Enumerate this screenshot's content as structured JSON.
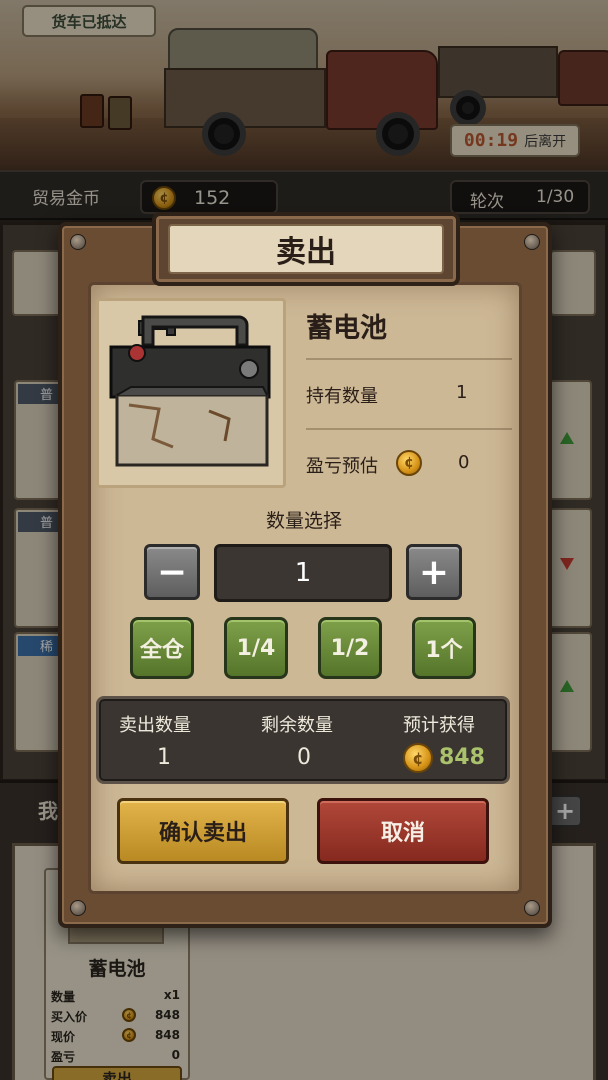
{
  "scene": {
    "arrived_label": "货车已抵达",
    "timer_value": "00:19",
    "timer_suffix": "后离开"
  },
  "hud": {
    "coins_label": "贸易金币",
    "coins_value": "152",
    "round_label": "轮次",
    "round_value": "1/30"
  },
  "market": {
    "rarity_tags": [
      "普",
      "普",
      "稀"
    ],
    "trends": [
      "up",
      "down",
      "up"
    ]
  },
  "inventory": {
    "title": "我",
    "add_icon": "plus-icon",
    "card": {
      "name": "蓄电池",
      "qty_label": "数量",
      "qty_value": "x1",
      "buy_label": "买入价",
      "buy_value": "848",
      "current_label": "现价",
      "current_value": "848",
      "pnl_label": "盈亏",
      "pnl_value": "0",
      "sell_label": "卖出"
    }
  },
  "dialog": {
    "title": "卖出",
    "item_name": "蓄电池",
    "held_label": "持有数量",
    "held_value": "1",
    "pnl_label": "盈亏预估",
    "pnl_value": "0",
    "qty_select_label": "数量选择",
    "minus_symbol": "−",
    "qty_value": "1",
    "plus_symbol": "+",
    "quick_buttons": [
      "全仓",
      "1/4",
      "1/2",
      "1个"
    ],
    "summary": {
      "sell_qty_label": "卖出数量",
      "sell_qty_value": "1",
      "remain_label": "剩余数量",
      "remain_value": "0",
      "expected_label": "预计获得",
      "expected_value": "848"
    },
    "confirm_label": "确认卖出",
    "cancel_label": "取消"
  },
  "colors": {
    "confirm": "#d3a63d",
    "cancel": "#a33a2e",
    "quick": "#6d8c3a",
    "gain": "#a9c26b"
  }
}
